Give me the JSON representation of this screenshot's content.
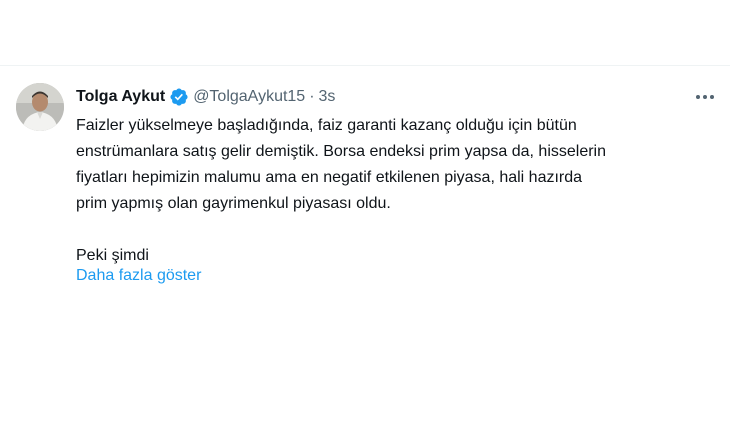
{
  "tweet": {
    "display_name": "Tolga Aykut",
    "handle": "@TolgaAykut15",
    "separator": "·",
    "time": "3s",
    "verified_icon": "verified-badge-icon",
    "more_icon": "more-horizontal-icon",
    "text": "Faizler yükselmeye başladığında, faiz garanti kazanç olduğu için bütün\nenstrümanlara satış gelir demiştik. Borsa endeksi prim yapsa da, hisselerin\nfiyatları hepimizin malumu ama en negatif etkilenen piyasa, hali hazırda\nprim yapmış olan gayrimenkul piyasası oldu.\n\nPeki şimdi",
    "show_more": "Daha fazla göster"
  },
  "colors": {
    "text_primary": "#0f1419",
    "text_secondary": "#536471",
    "link": "#1d9bf0",
    "verified": "#1d9bf0",
    "border": "#eff3f4"
  }
}
